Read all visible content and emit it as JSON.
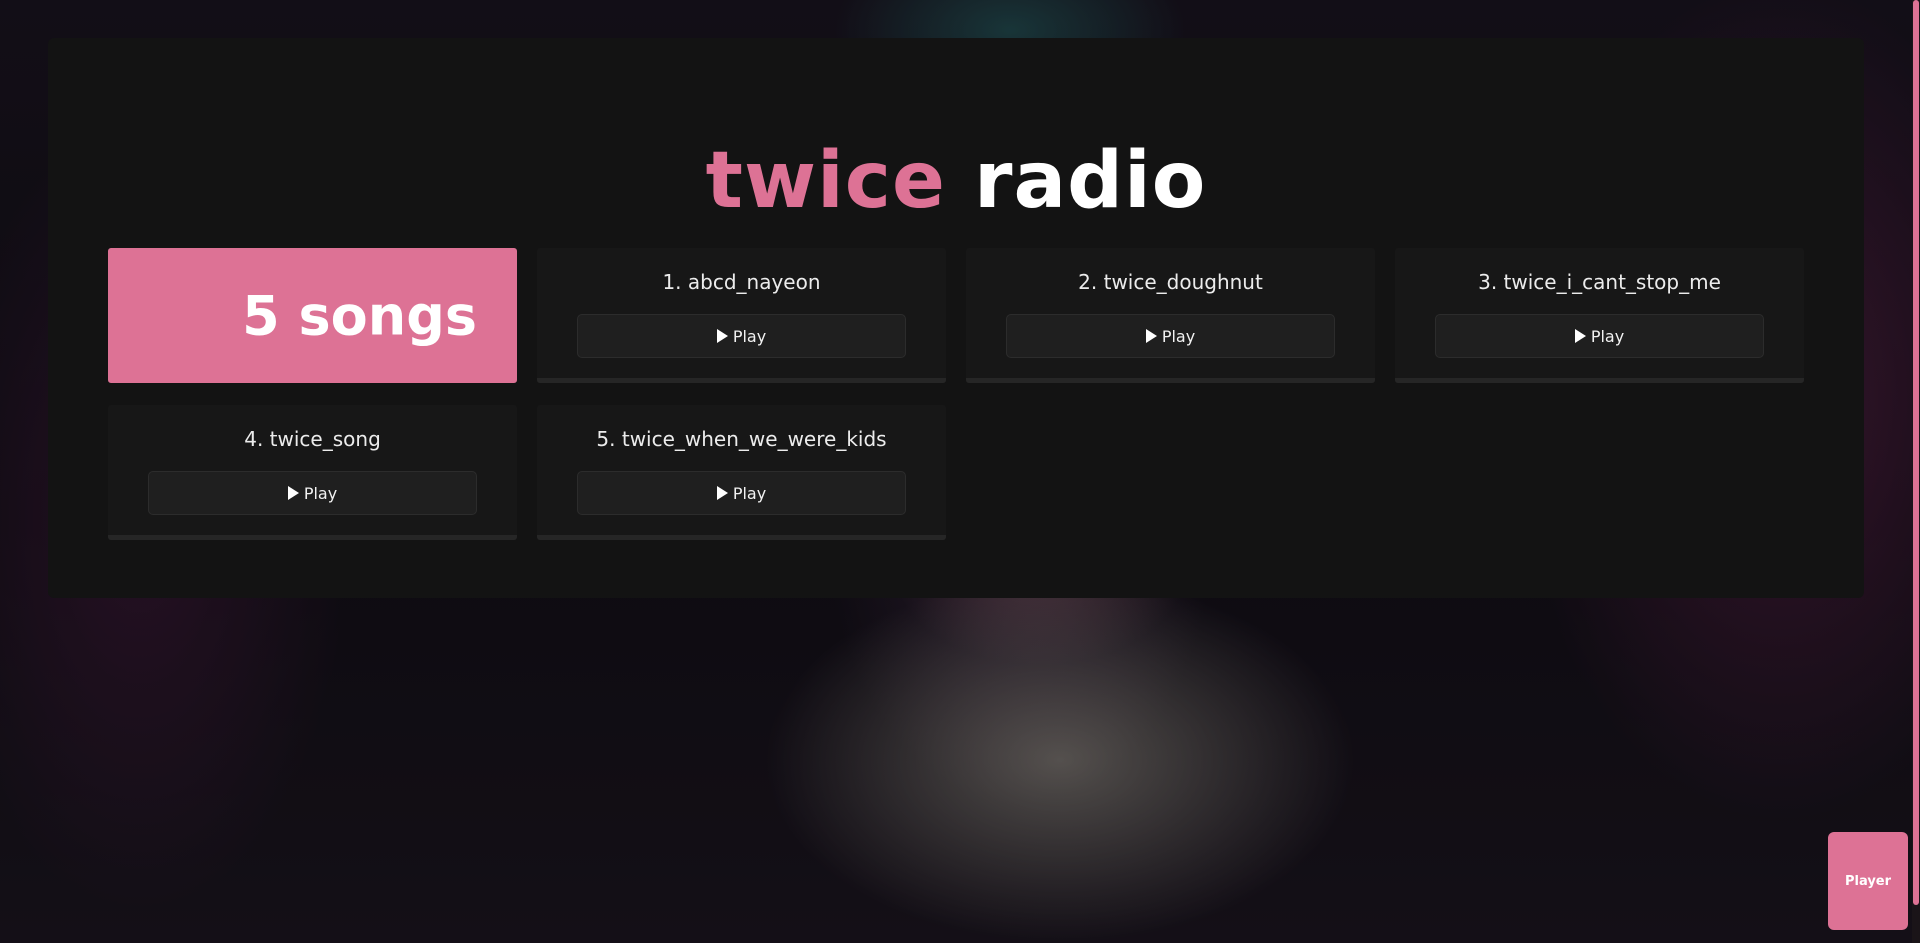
{
  "title": {
    "accent": "twice",
    "rest": "radio"
  },
  "count_card": {
    "label": "5 songs"
  },
  "songs": [
    {
      "title": "1. abcd_nayeon",
      "button_label": "Play"
    },
    {
      "title": "2. twice_doughnut",
      "button_label": "Play"
    },
    {
      "title": "3. twice_i_cant_stop_me",
      "button_label": "Play"
    },
    {
      "title": "4. twice_song",
      "button_label": "Play"
    },
    {
      "title": "5. twice_when_we_were_kids",
      "button_label": "Play"
    }
  ],
  "player_button": {
    "label": "Player"
  },
  "colors": {
    "accent": "#dd7295",
    "panel": "#131313",
    "card": "#171717"
  },
  "icons": {
    "play": "play-icon"
  }
}
